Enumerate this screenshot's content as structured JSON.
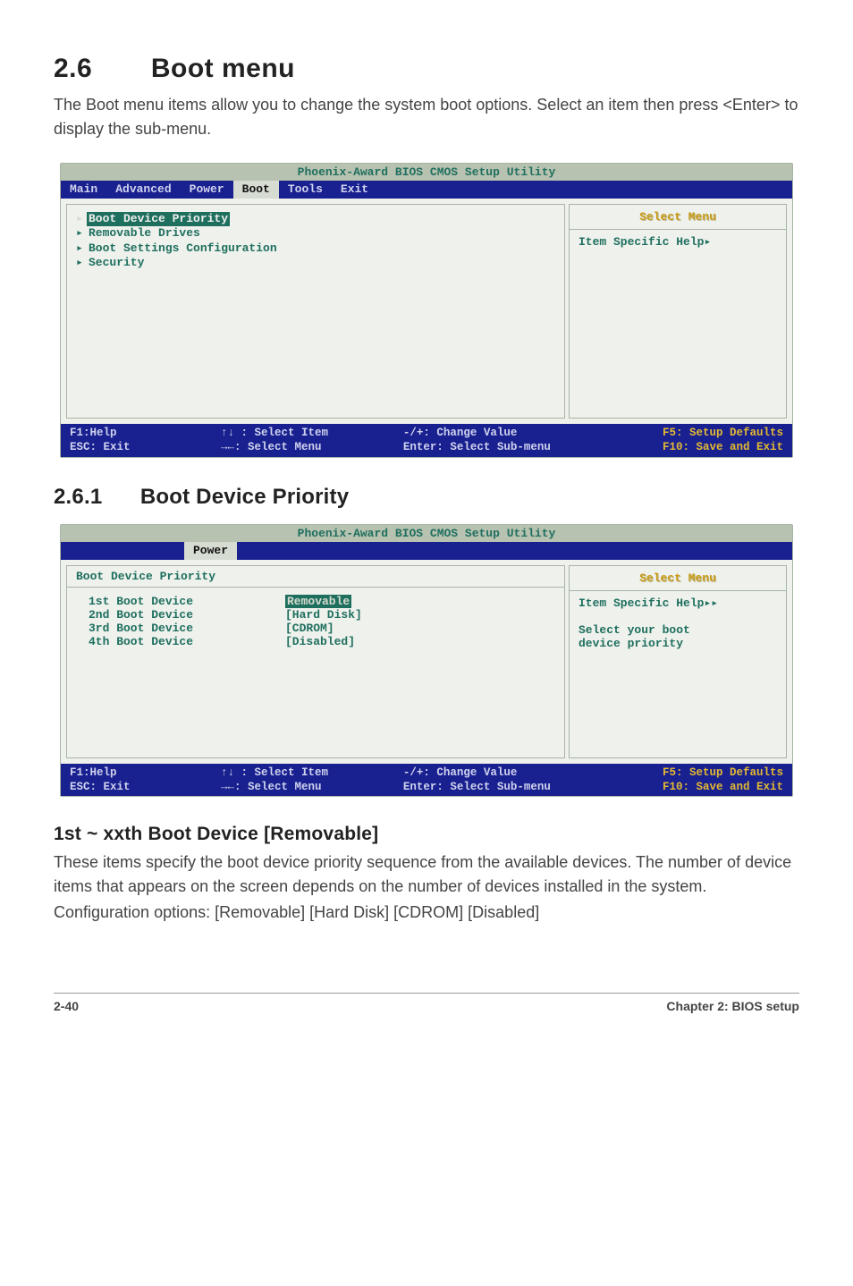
{
  "heading": {
    "number": "2.6",
    "title": "Boot menu"
  },
  "intro": "The Boot menu items allow you to change the system boot options. Select an item then press <Enter> to display the sub-menu.",
  "bios1": {
    "title": "Phoenix-Award BIOS CMOS Setup Utility",
    "tabs": [
      "Main",
      "Advanced",
      "Power",
      "Boot",
      "Tools",
      "Exit"
    ],
    "active_tab": "Boot",
    "items": [
      {
        "label": "Boot Device Priority",
        "selected": true
      },
      {
        "label": "Removable Drives",
        "selected": false
      },
      {
        "label": "Boot Settings Configuration",
        "selected": false
      },
      {
        "label": "Security",
        "selected": false
      }
    ],
    "right": {
      "select_menu": "Select Menu",
      "help_label": "Item Specific Help",
      "help_body": ""
    },
    "footer": {
      "c1a": "F1:Help",
      "c2a": "↑↓ : Select Item",
      "c3a": "-/+: Change Value",
      "c4a": "F5: Setup Defaults",
      "c1b": "ESC: Exit",
      "c2b": "→←: Select Menu",
      "c3b": "Enter: Select Sub-menu",
      "c4b": "F10: Save and Exit"
    }
  },
  "sub": {
    "number": "2.6.1",
    "title": "Boot Device Priority"
  },
  "bios2": {
    "title": "Phoenix-Award BIOS CMOS Setup Utility",
    "tabs": [
      "",
      "",
      "Power",
      "",
      "",
      ""
    ],
    "active_tab": "Power",
    "panel_heading": "Boot Device Priority",
    "rows": [
      {
        "label": "1st Boot Device",
        "value": "Removable",
        "selected": true
      },
      {
        "label": "2nd Boot Device",
        "value": "[Hard Disk]",
        "selected": false
      },
      {
        "label": "3rd Boot Device",
        "value": "[CDROM]",
        "selected": false
      },
      {
        "label": "4th Boot Device",
        "value": "[Disabled]",
        "selected": false
      }
    ],
    "right": {
      "select_menu": "Select Menu",
      "help_label": "Item Specific Help",
      "help_body1": "Select your boot",
      "help_body2": "device priority"
    },
    "footer": {
      "c1a": "F1:Help",
      "c2a": "↑↓ : Select Item",
      "c3a": "-/+: Change Value",
      "c4a": "F5: Setup Defaults",
      "c1b": "ESC: Exit",
      "c2b": "→←: Select Menu",
      "c3b": "Enter: Select Sub-menu",
      "c4b": "F10: Save and Exit"
    }
  },
  "opt_heading": "1st ~ xxth Boot Device [Removable]",
  "opt_body1": "These items specify the boot device priority sequence from the available devices. The number of device items that appears on the screen depends on the number of devices installed in the system.",
  "opt_body2": "Configuration options: [Removable] [Hard Disk] [CDROM] [Disabled]",
  "page_no": "2-40",
  "chapter": "Chapter 2: BIOS setup"
}
